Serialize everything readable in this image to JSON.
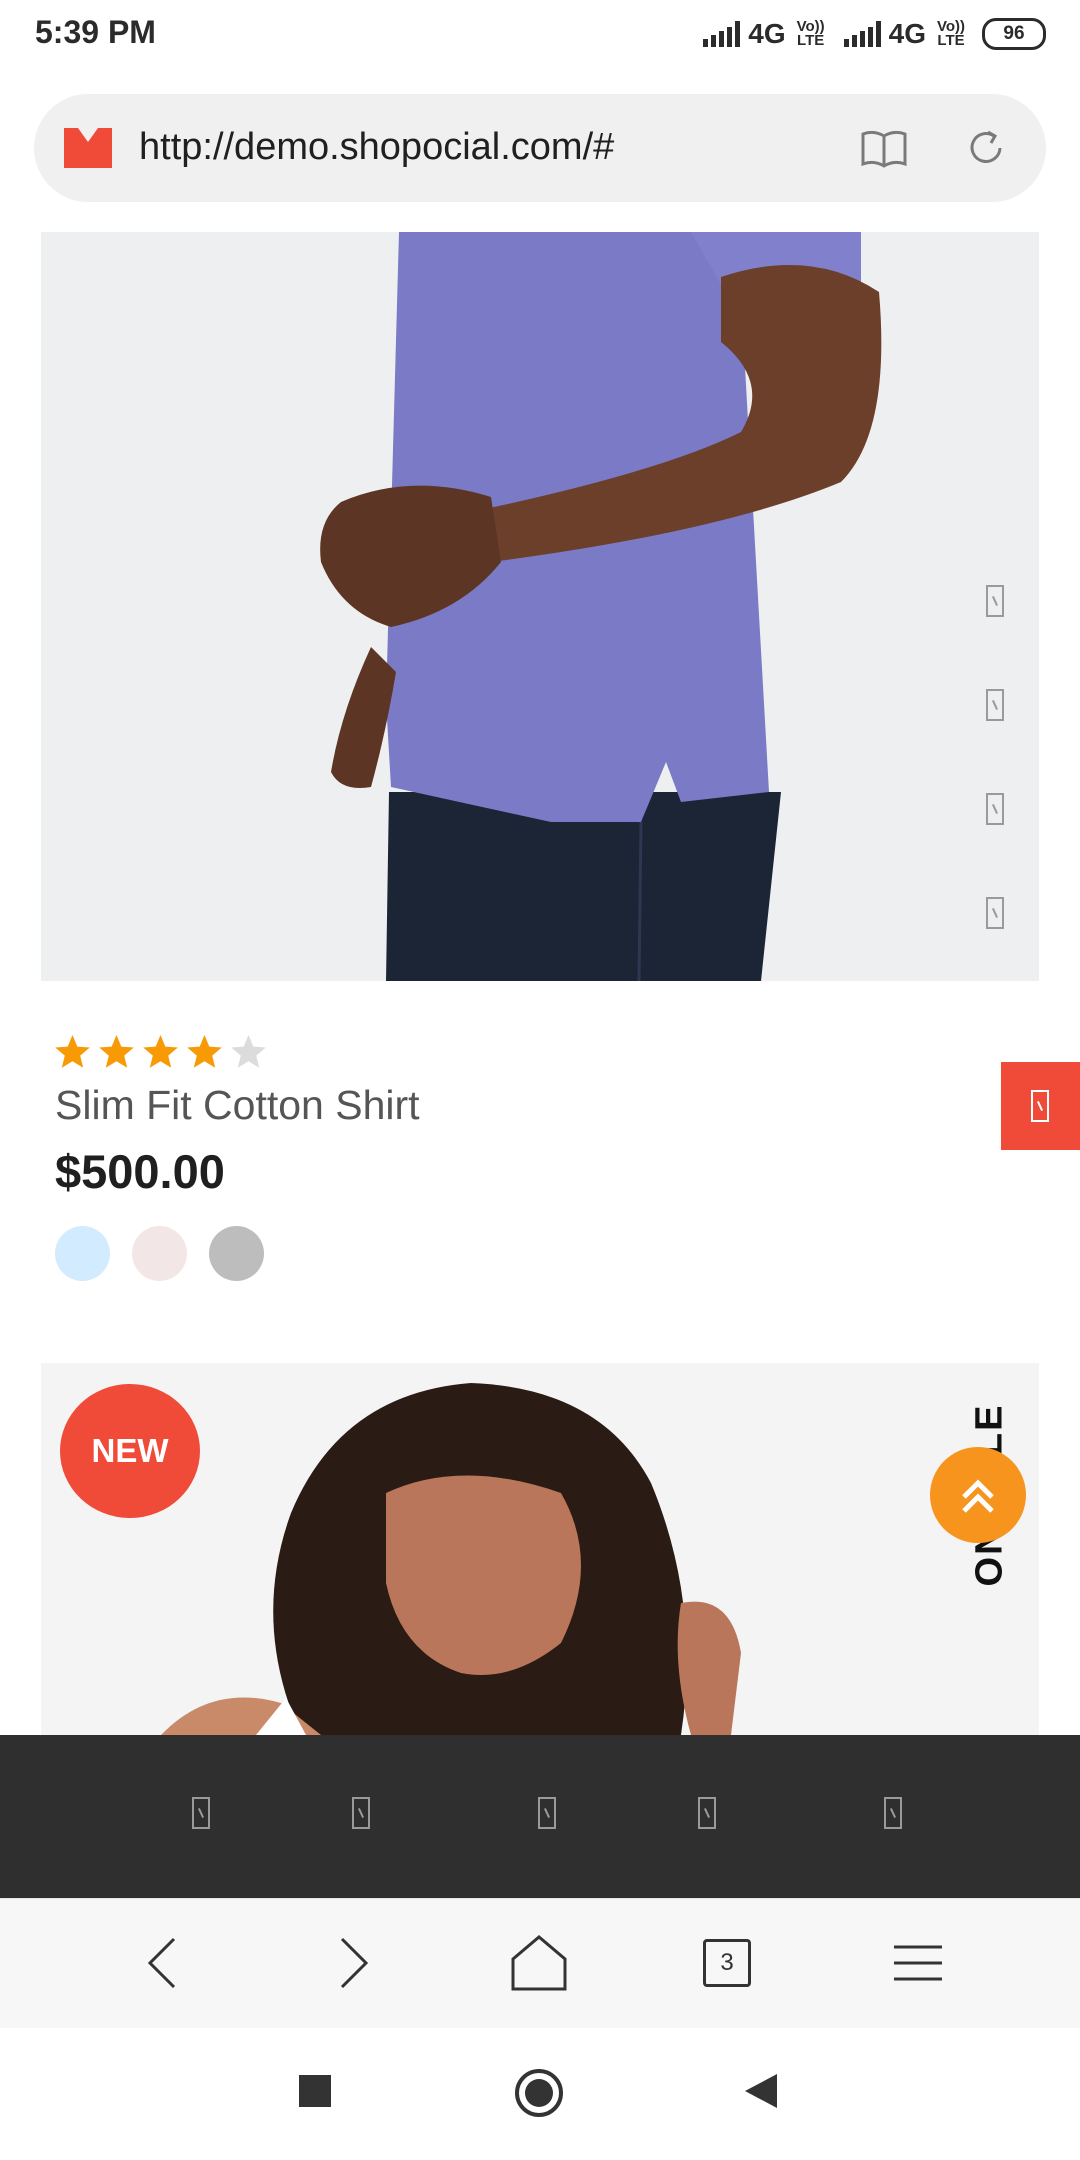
{
  "status_bar": {
    "time": "5:39 PM",
    "network_1": "4G",
    "volte_1": "Vo)) LTE",
    "network_2": "4G",
    "volte_2": "Vo)) LTE",
    "battery": "96"
  },
  "browser": {
    "url": "http://demo.shopocial.com/#",
    "tabs_count": "3"
  },
  "product_1": {
    "rating": 4,
    "rating_max": 5,
    "title": "Slim Fit Cotton Shirt",
    "price": "$500.00",
    "swatches": [
      "#d2ebff",
      "#f3e6e6",
      "#bdbdbd"
    ]
  },
  "product_2": {
    "badge": "NEW",
    "vertical_label": "ON SALE"
  },
  "colors": {
    "accent_red": "#f04b39",
    "accent_orange": "#f7941d",
    "star": "#f79a06",
    "dark_nav": "#2f2f2f"
  }
}
